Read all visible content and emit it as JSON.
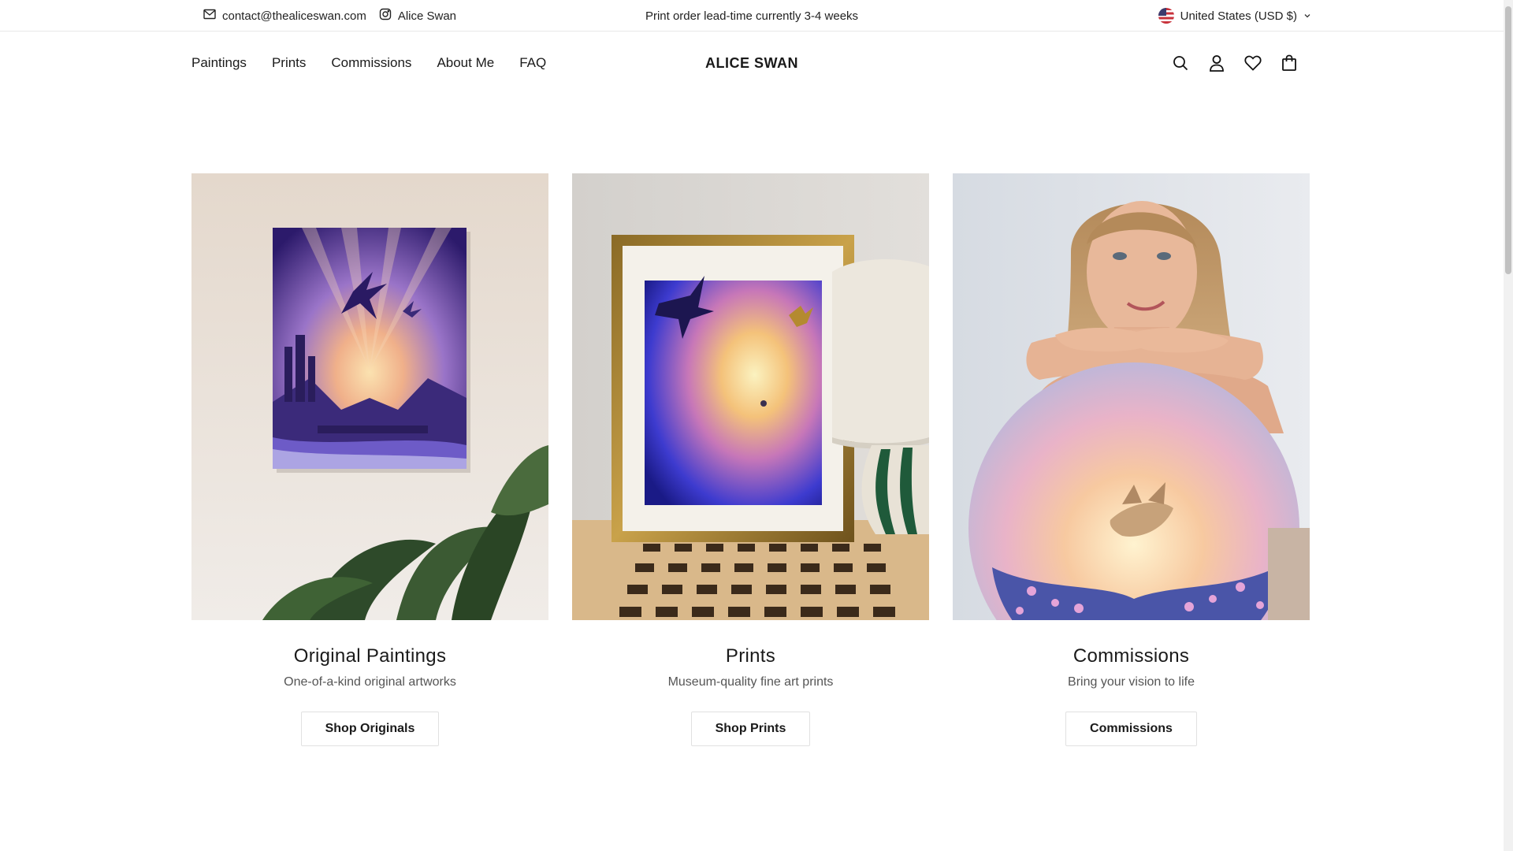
{
  "topbar": {
    "email": "contact@thealiceswan.com",
    "instagram": "Alice Swan",
    "announcement": "Print order lead-time currently 3-4 weeks",
    "currency": "United States (USD $)"
  },
  "header": {
    "logo": "ALICE SWAN",
    "nav": [
      "Paintings",
      "Prints",
      "Commissions",
      "About Me",
      "FAQ"
    ],
    "icons": [
      "search-icon",
      "account-icon",
      "wishlist-heart-icon",
      "cart-bag-icon"
    ]
  },
  "collections": [
    {
      "title": "Original Paintings",
      "subtitle": "One-of-a-kind original artworks",
      "button": "Shop Originals"
    },
    {
      "title": "Prints",
      "subtitle": "Museum-quality fine art prints",
      "button": "Shop Prints"
    },
    {
      "title": "Commissions",
      "subtitle": "Bring your vision to life",
      "button": "Commissions"
    }
  ],
  "colors": {
    "text": "#1a1a1a",
    "muted": "#555555",
    "border": "#e1e1e1",
    "painting_purple": "#5b3fa8",
    "sunset_glow": "#f7c9a0"
  }
}
